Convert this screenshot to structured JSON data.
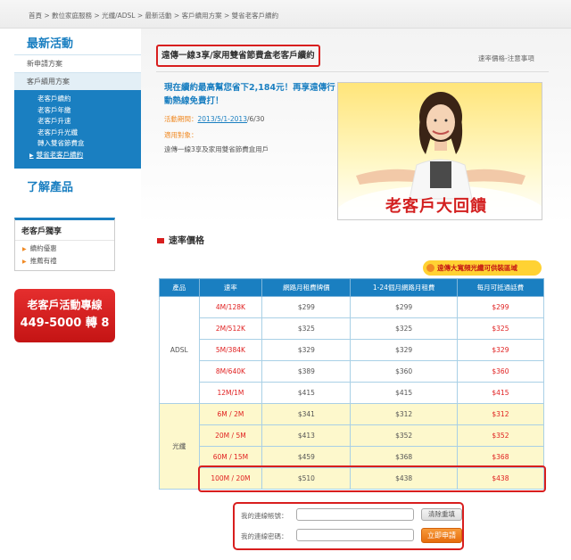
{
  "breadcrumb": "首頁 > 數位家庭服務 > 光纖/ADSL > 最新活動 > 客戶續用方案 > 雙省老客戶續約",
  "sidebar": {
    "section1_title": "最新活動",
    "item_new": "新申請方案",
    "item_renew": "客戶續用方案",
    "sub_items": [
      "老客戶續約",
      "老客戶年繳",
      "老客戶升速",
      "老客戶升光纖",
      "轉入雙省節費盒",
      "雙省老客戶續約"
    ],
    "section2_title": "了解產品"
  },
  "exclusive": {
    "title": "老客戶獨享",
    "items": [
      "續約優惠",
      "推薦有禮"
    ]
  },
  "hotline": {
    "line1": "老客戶活動專線",
    "line2": "449-5000 轉 8"
  },
  "page_title": "遠傳一線3享/家用雙省節費盒老客戶續約",
  "top_link": "速率價格-注意事項",
  "promo": {
    "prefix": "現在續約最高幫您省下",
    "amount": "2,184元",
    "suffix": "！再享遠傳行動熱線免費打！"
  },
  "period": {
    "label": "活動期間：",
    "link": "2013/5/1-2013",
    "end": "/6/30"
  },
  "applies": {
    "label": "適用對象：",
    "value": "遠傳一線3享及家用雙省節費盒用戶"
  },
  "banner_text": "老客戶大回饋",
  "section_title": "速率價格",
  "fiber_badge": "遠傳大寬頻光纖可供裝區域",
  "table": {
    "headers": [
      "產品",
      "速率",
      "網路月租費牌價",
      "1-24個月網路月租費",
      "每月可抵通話費"
    ],
    "adsl_label": "ADSL",
    "fiber_label": "光纖",
    "adsl_rows": [
      [
        "4M/128K",
        "$299",
        "$299",
        "$299"
      ],
      [
        "2M/512K",
        "$325",
        "$325",
        "$325"
      ],
      [
        "5M/384K",
        "$329",
        "$329",
        "$329"
      ],
      [
        "8M/640K",
        "$389",
        "$360",
        "$360"
      ],
      [
        "12M/1M",
        "$415",
        "$415",
        "$415"
      ]
    ],
    "fiber_rows": [
      [
        "6M / 2M",
        "$341",
        "$312",
        "$312"
      ],
      [
        "20M / 5M",
        "$413",
        "$352",
        "$352"
      ],
      [
        "60M / 15M",
        "$459",
        "$368",
        "$368"
      ],
      [
        "100M / 20M",
        "$510",
        "$438",
        "$438"
      ]
    ]
  },
  "login": {
    "account_label": "我的連線帳號：",
    "password_label": "我的連線密碼：",
    "clear_button": "清除重填",
    "apply_button": "立即申請"
  },
  "colors": {
    "brand_blue": "#1a7fc1",
    "highlight_red": "#d81e1e",
    "accent_orange": "#f08a24",
    "fiber_row_bg": "#fdf8cc"
  }
}
